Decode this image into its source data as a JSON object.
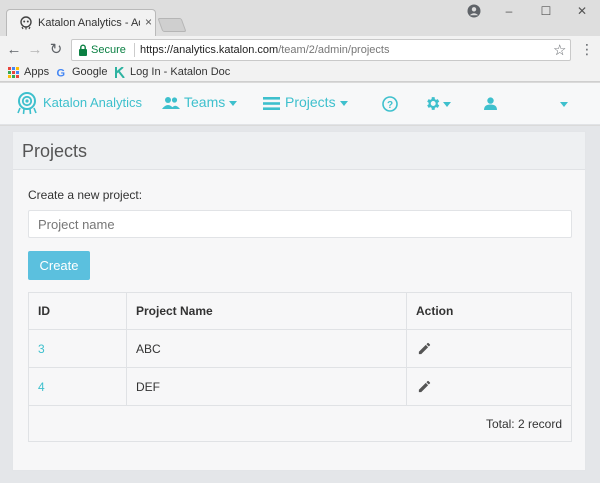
{
  "browser": {
    "tab_title": "Katalon Analytics - Admin",
    "tab_close": "×",
    "window_controls": {
      "minimize": "–",
      "maximize": "☐",
      "close": "✕"
    },
    "nav": {
      "back": "←",
      "forward": "→",
      "reload": "↻"
    },
    "secure_label": "Secure",
    "url_host": "https://analytics.katalon.com",
    "url_path": "/team/2/admin/projects",
    "bookmark_star": "☆",
    "menu_dots": "⋮",
    "bookmarks": [
      {
        "label": "Apps",
        "icon": "apps-grid-icon"
      },
      {
        "label": "Google",
        "icon": "google-icon"
      },
      {
        "label": "Log In - Katalon Doc",
        "icon": "katalon-k-icon"
      }
    ]
  },
  "navbar": {
    "brand": "Katalon Analytics",
    "teams_label": "Teams",
    "projects_label": "Projects",
    "help_icon": "help-circle-icon",
    "settings_icon": "gear-icon",
    "user_icon": "user-icon",
    "accent_color": "#3ec0cd"
  },
  "page": {
    "title": "Projects",
    "create_label": "Create a new project:",
    "input_placeholder": "Project name",
    "input_value": "",
    "create_button": "Create",
    "button_color": "#5bc0de"
  },
  "table": {
    "headers": {
      "id": "ID",
      "name": "Project Name",
      "action": "Action"
    },
    "rows": [
      {
        "id": "3",
        "name": "ABC",
        "action_icon": "pencil-icon"
      },
      {
        "id": "4",
        "name": "DEF",
        "action_icon": "pencil-icon"
      }
    ],
    "total": "Total: 2 record"
  }
}
